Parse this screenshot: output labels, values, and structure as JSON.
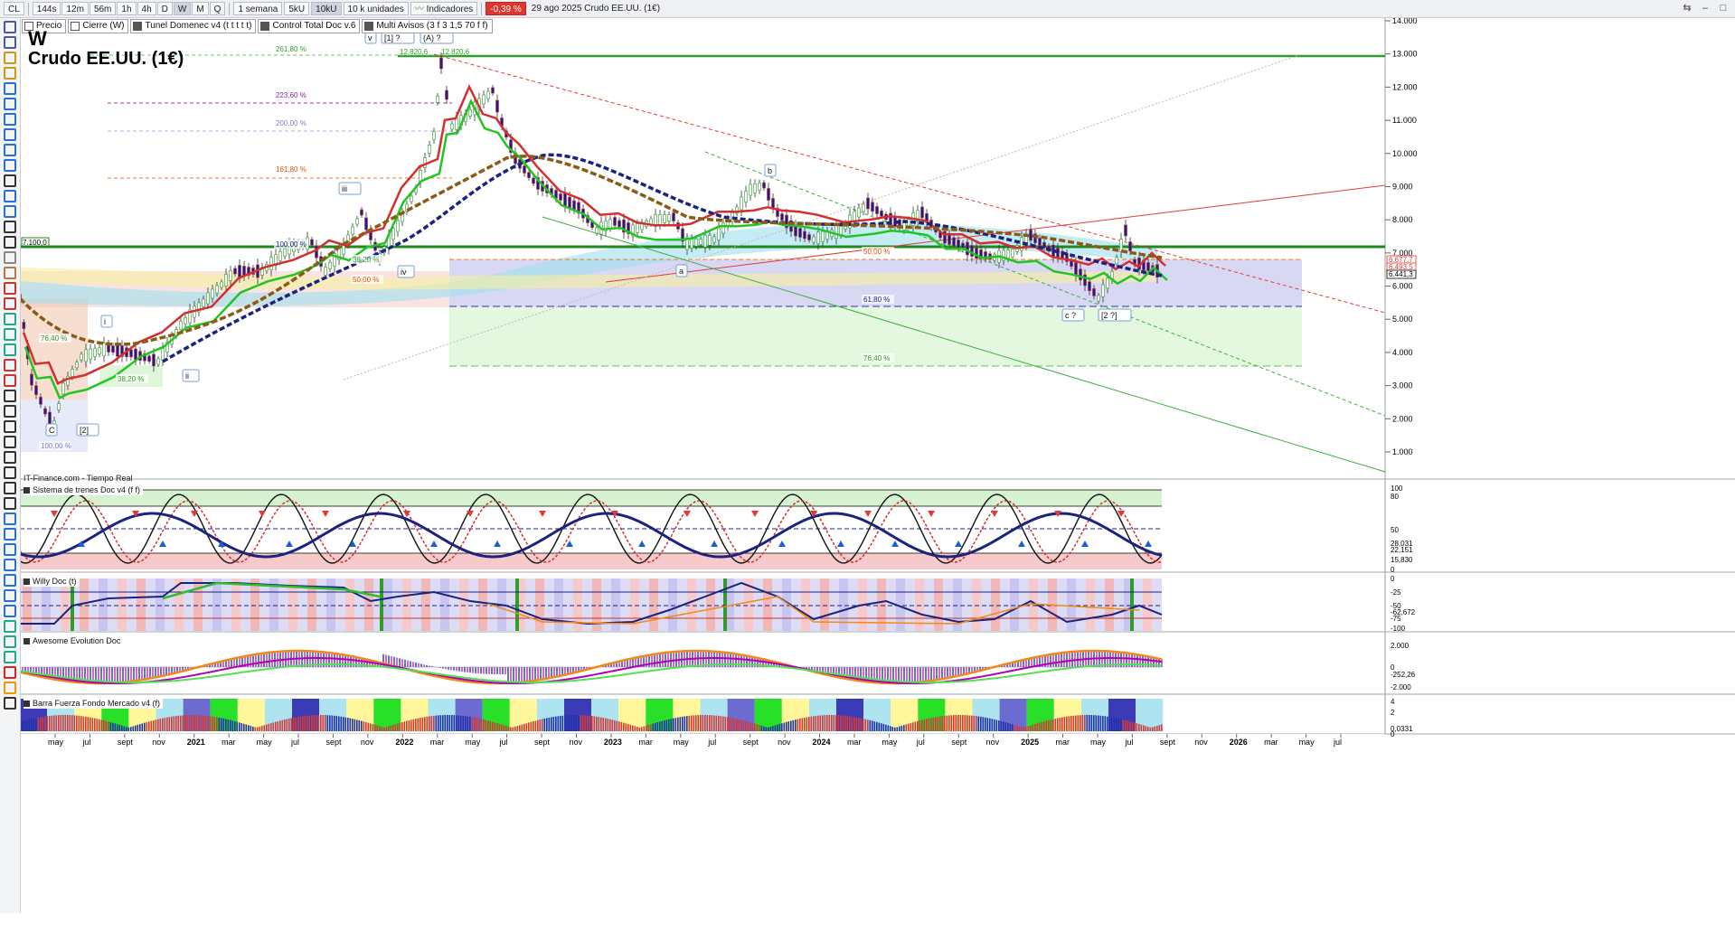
{
  "toolbar": {
    "symbol": "CL",
    "timeframes": [
      "144s",
      "12m",
      "56m",
      "1h",
      "4h",
      "D",
      "W",
      "M",
      "Q"
    ],
    "active_timeframe": "W",
    "period": "1 semana",
    "units_5k": "5kU",
    "units_10k": "10kU",
    "units_select": "10 k unidades",
    "indicators_label": "Indicadores",
    "change_badge": "-0,39 %",
    "date_info": "29 ago 2025  Crudo EE.UU. (1€)"
  },
  "toggles": [
    {
      "label": "Precio",
      "on": false
    },
    {
      "label": "Cierre (W)",
      "on": false
    },
    {
      "label": "Tunel Domenec v4 (t t t t t)",
      "on": true
    },
    {
      "label": "Control Total Doc v.6",
      "on": true
    },
    {
      "label": "Multi Avisos (3 f 3 1,5 70 f f)",
      "on": true
    }
  ],
  "main": {
    "title_letter": "W",
    "title_name": "Crudo EE.UU. (1€)",
    "source": "IT-Finance.com - Tiempo Real",
    "price_axis": [
      "14.000",
      "13.000",
      "12.000",
      "11.000",
      "10.000",
      "9.000",
      "8.000",
      "7.000",
      "6.000",
      "5.000",
      "4.000",
      "3.000",
      "2.000",
      "1.000"
    ],
    "price_tags": [
      {
        "text": "6.677,7",
        "color": "#e53935"
      },
      {
        "text": "6.493,5",
        "color": "#e53935"
      },
      {
        "text": "6.441,3",
        "color": "#000000"
      }
    ],
    "level_label": "7.100,0",
    "fib_labels": [
      "261,80 %",
      "223,60 %",
      "200,00 %",
      "161,80 %",
      "100,00 %",
      "38,20 %",
      "50,00 %",
      "50,00 %",
      "61,80 %",
      "76,40 %",
      "76,40 %",
      "38,20 %",
      "100,00 %"
    ],
    "peak_labels": [
      "12.820,6",
      "12.820,6"
    ],
    "wave_labels": [
      "v",
      "[1] ?",
      "(A) ?",
      "iii",
      "iv",
      "i",
      "ii",
      "C",
      "[2]",
      "a",
      "b",
      "c ?",
      "[2 ?]"
    ]
  },
  "panels": [
    {
      "name": "Sistema de trenes Doc v4 (f f)",
      "axis": [
        "100",
        "80",
        "50",
        "28,031",
        "22,151",
        "15,830",
        "0"
      ]
    },
    {
      "name": "Willy Doc (t)",
      "axis": [
        "0",
        "-25",
        "-50",
        "-62,672",
        "-75",
        "-100"
      ]
    },
    {
      "name": "Awesome Evolution Doc",
      "axis": [
        "2.000",
        "0",
        "-252,26",
        "-2.000"
      ]
    },
    {
      "name": "Barra Fuerza Fondo Mercado v4 (f)",
      "axis": [
        "4",
        "2",
        "0,0331",
        "0"
      ]
    }
  ],
  "time_axis": [
    "may",
    "jul",
    "sept",
    "nov",
    "2021",
    "mar",
    "may",
    "jul",
    "sept",
    "nov",
    "2022",
    "mar",
    "may",
    "jul",
    "sept",
    "nov",
    "2023",
    "mar",
    "may",
    "jul",
    "sept",
    "nov",
    "2024",
    "mar",
    "may",
    "jul",
    "sept",
    "nov",
    "2025",
    "mar",
    "may",
    "jul",
    "sept",
    "nov",
    "2026",
    "mar",
    "may",
    "jul"
  ],
  "colors": {
    "accent_green": "#2e9d2e",
    "accent_red": "#e53935",
    "accent_blue": "#1a237e",
    "fib_zone_blue": "#c9c8f0",
    "fib_zone_green": "#d7f5d0"
  }
}
